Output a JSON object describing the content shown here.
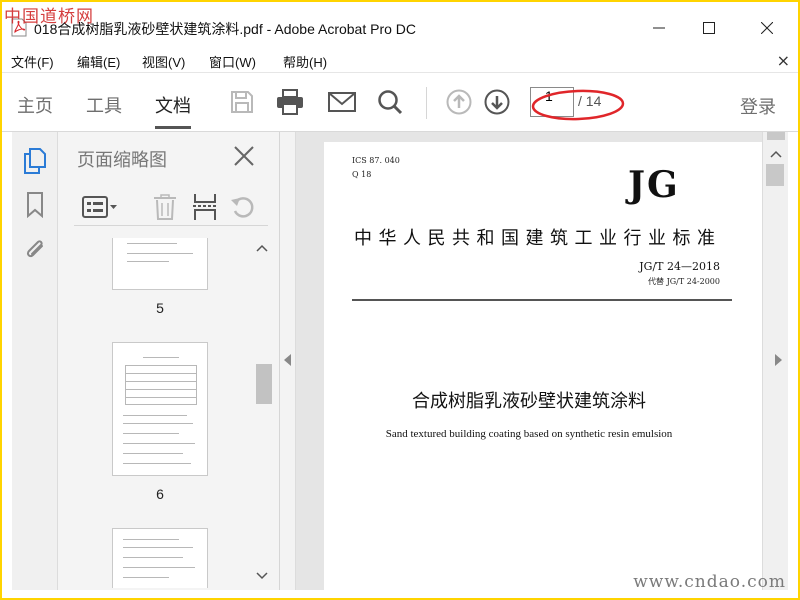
{
  "watermark": {
    "top_left": "中国道桥网",
    "bottom_right": "www.cndao.com"
  },
  "window": {
    "title": "018合成树脂乳液砂壁状建筑涂料.pdf - Adobe Acrobat Pro DC"
  },
  "menu": [
    "文件(F)",
    "编辑(E)",
    "视图(V)",
    "窗口(W)",
    "帮助(H)"
  ],
  "toolbar": {
    "tabs": [
      "主页",
      "工具",
      "文档"
    ],
    "active_tab": "文档",
    "current_page": "1",
    "total_pages": "/ 14",
    "login": "登录",
    "annotation_color": "#e0262a"
  },
  "panel": {
    "title": "页面缩略图",
    "thumbnails": [
      {
        "label": "5"
      },
      {
        "label": "6"
      },
      {
        "label": ""
      }
    ]
  },
  "document": {
    "ics": "ICS   87. 040",
    "q18": "Q  18",
    "mark": "JG",
    "standard_title": "中华人民共和国建筑工业行业标准",
    "standard_no": "JG/T 24—2018",
    "replaces": "代替  JG/T 24-2000",
    "cn_title": "合成树脂乳液砂壁状建筑涂料",
    "en_title": "Sand textured building coating based on synthetic resin emulsion"
  },
  "colors": {
    "accent": "#2b7bd6",
    "frame": "#ffd400"
  }
}
